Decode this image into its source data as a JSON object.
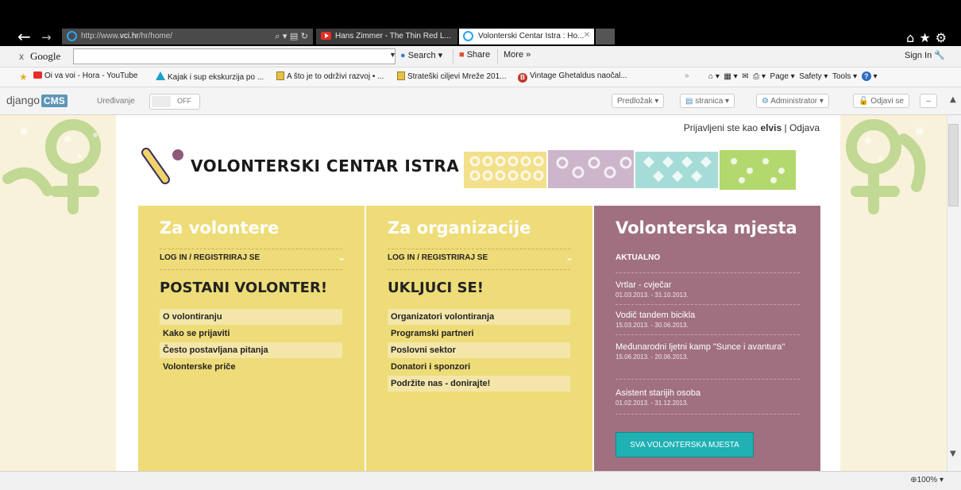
{
  "browser": {
    "address_url": "http://www.vci.hr/hr/home/",
    "address_prefix": "http://www.",
    "address_domain": "vci.hr",
    "address_path": "/hr/home/",
    "tabs": [
      {
        "title": "Hans Zimmer - The Thin Red L..."
      },
      {
        "title": "Volonterski Centar Istra : Ho..."
      }
    ],
    "nav_icons": [
      "back-arrow-icon",
      "forward-arrow-icon"
    ],
    "window_icons": [
      "home-icon",
      "favorites-star-icon",
      "settings-gear-icon"
    ]
  },
  "google_toolbar": {
    "close": "x",
    "logo": "Google",
    "search_value": "",
    "search_button": "Search",
    "share_button": "Share",
    "more_button": "More »",
    "sign_in": "Sign In"
  },
  "favorites": {
    "items": [
      {
        "label": "Oi va voi - Hora - YouTube",
        "icon": "youtube-icon"
      },
      {
        "label": "Kajak i sup ekskurzija po ...",
        "icon": "triangle-icon"
      },
      {
        "label": "A što je to održivi razvoj • ...",
        "icon": "page-icon"
      },
      {
        "label": "Strateški ciljevi Mreže 201...",
        "icon": "page-icon"
      },
      {
        "label": "Vintage Ghetaldus naočal...",
        "icon": "b-icon"
      }
    ],
    "commands": {
      "page": "Page",
      "safety": "Safety",
      "tools": "Tools"
    }
  },
  "cms_toolbar": {
    "logo_text": "django",
    "logo_badge": "CMS",
    "edit_label": "Uređivanje",
    "toggle_state": "OFF",
    "template_button": "Predložak",
    "page_button": "stranica",
    "admin_button": "Administrator",
    "logout_button": "Odjavi se",
    "minimize_button": "–"
  },
  "site": {
    "login_prefix": "Prijavljeni ste kao",
    "login_user": "elvis",
    "login_separator": "|",
    "logout_link": "Odjava",
    "title": "VOLONTERSKI CENTAR ISTRA",
    "colors": {
      "yellow": "#eedc78",
      "mauve": "#a07080",
      "teal": "#1fb1b3",
      "page_bg": "#f9f2da"
    }
  },
  "columns": {
    "volunteers": {
      "title": "Za volontere",
      "login_register": "LOG IN / REGISTRIRAJ SE",
      "headline": "POSTANI VOLONTER!",
      "links": [
        "O volontiranju",
        "Kako se prijaviti",
        "Često postavljana pitanja",
        "Volonterske priče"
      ]
    },
    "organizations": {
      "title": "Za organizacije",
      "login_register": "LOG IN / REGISTRIRAJ SE",
      "headline": "UKLJUCI SE!",
      "links": [
        "Organizatori volontiranja",
        "Programski partneri",
        "Poslovni sektor",
        "Donatori i sponzori",
        "Podržite nas - donirajte!"
      ]
    },
    "positions": {
      "title": "Volonterska mjesta",
      "current_label": "AKTUALNO",
      "jobs": [
        {
          "title": "Vrtlar - cvječar",
          "dates": "01.03.2013. - 31.10.2013."
        },
        {
          "title": "Vodič tandem bicikla",
          "dates": "15.03.2013. - 30.06.2013."
        },
        {
          "title": "Međunarodni ljetni kamp \"Sunce i avantura\"",
          "dates": "15.06.2013. - 20.06.2013."
        },
        {
          "title": "Asistent starijih osoba",
          "dates": "01.02.2013. - 31.12.2013."
        }
      ],
      "all_button": "SVA VOLONTERSKA MJESTA"
    }
  },
  "statusbar": {
    "zoom": "100%"
  }
}
